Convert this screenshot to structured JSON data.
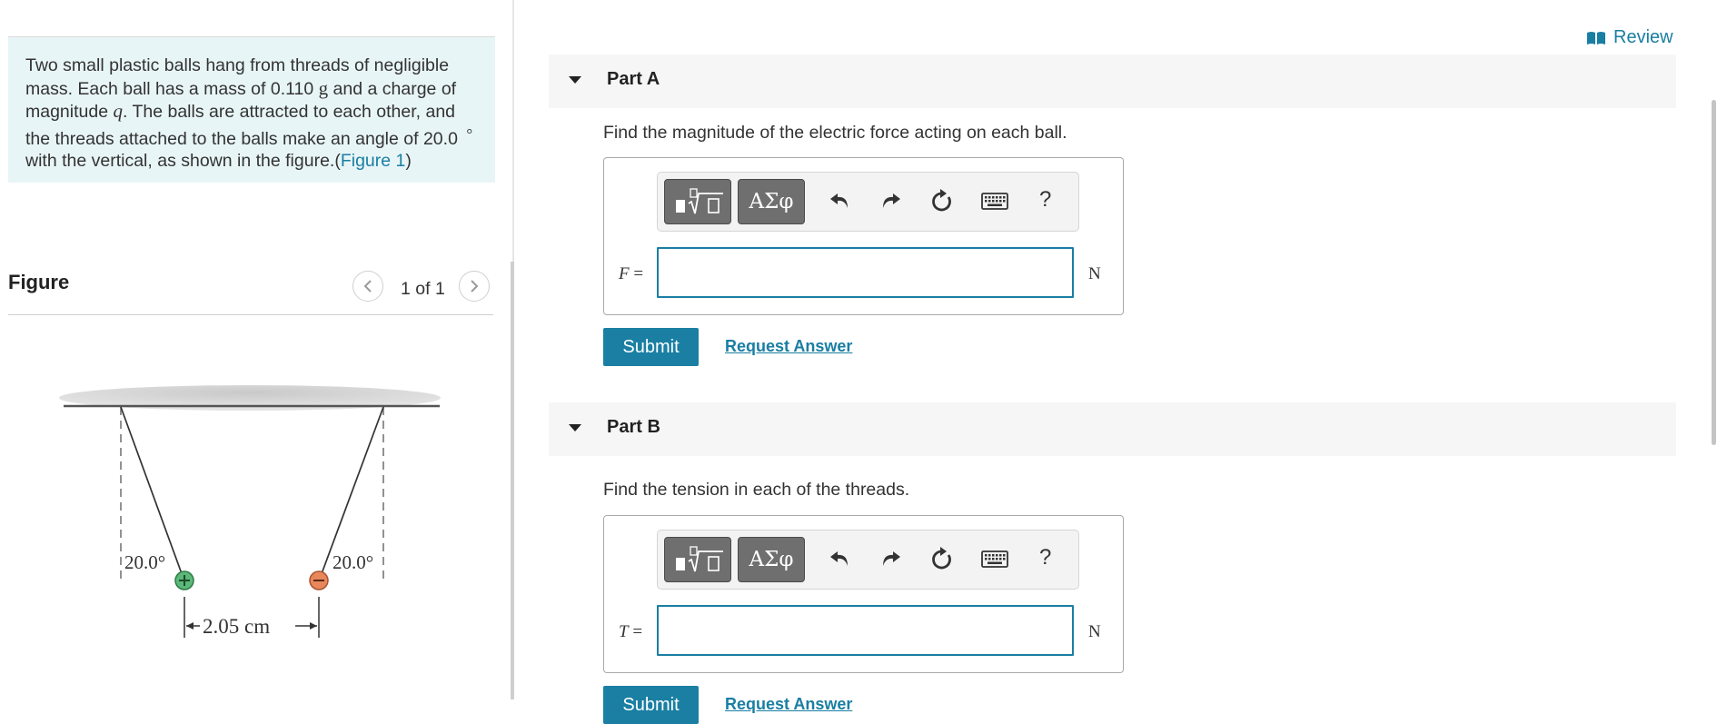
{
  "problem": {
    "text_1": "Two small plastic balls hang from threads of negligible mass. Each ball has a mass of 0.110 ",
    "mass_unit": "g",
    "text_2": " and a charge of magnitude ",
    "charge_symbol": "q",
    "text_3": ". The balls are attracted to each other, and the threads attached to the balls make an angle of 20.0 ",
    "degree_symbol": "°",
    "text_4": " with the vertical, as shown in the figure.(",
    "figure_link": "Figure 1",
    "text_5": ")"
  },
  "figure_panel": {
    "title": "Figure",
    "count": "1 of 1",
    "angle_left": "20.0°",
    "angle_right": "20.0°",
    "separation": "2.05 cm"
  },
  "review": {
    "label": "Review"
  },
  "parts": {
    "a": {
      "label": "Part A",
      "prompt": "Find the magnitude of the electric force acting on each ball.",
      "variable": "F",
      "equals": " =",
      "unit": "N",
      "greek_button": "ΑΣφ",
      "help": "?",
      "submit": "Submit",
      "request": "Request Answer"
    },
    "b": {
      "label": "Part B",
      "prompt": "Find the tension in each of the threads.",
      "variable": "T",
      "equals": " =",
      "unit": "N",
      "greek_button": "ΑΣφ",
      "help": "?",
      "submit": "Submit",
      "request": "Request Answer"
    }
  },
  "colors": {
    "accent": "#1a7ea3",
    "problem_bg": "#e8f5f7",
    "positive_ball": "#5cb878",
    "negative_ball": "#e8875b"
  }
}
